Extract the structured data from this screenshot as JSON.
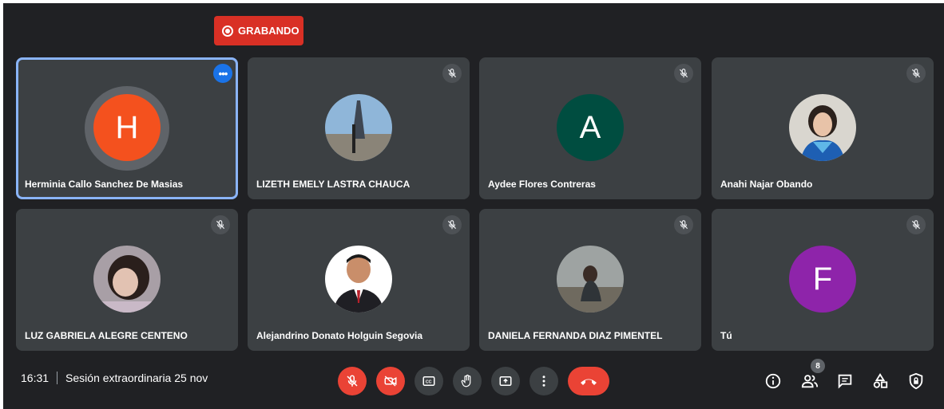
{
  "recording": {
    "label": "GRABANDO",
    "color": "#d93025"
  },
  "participants": [
    {
      "name": "Herminia Callo Sanchez De Masias",
      "initial": "H",
      "avatar_color": "#f4511e",
      "muted": false,
      "active": true,
      "options": true
    },
    {
      "name": "LIZETH EMELY LASTRA CHAUCA",
      "initial": "",
      "avatar": "photo-eiffel-tower",
      "muted": true
    },
    {
      "name": "Aydee Flores Contreras",
      "initial": "A",
      "avatar_color": "#004d40",
      "muted": true
    },
    {
      "name": "Anahi Najar Obando",
      "initial": "",
      "avatar": "photo-woman-blue-scarf",
      "muted": true
    },
    {
      "name": "LUZ GABRIELA ALEGRE CENTENO",
      "initial": "",
      "avatar": "photo-girl-selfie",
      "muted": true
    },
    {
      "name": "Alejandrino Donato Holguin Segovia",
      "initial": "",
      "avatar": "photo-man-suit",
      "muted": true
    },
    {
      "name": "DANIELA FERNANDA DIAZ PIMENTEL",
      "initial": "",
      "avatar": "photo-woman-landscape",
      "muted": true
    },
    {
      "name": "Tú",
      "initial": "F",
      "avatar_color": "#8e24aa",
      "muted": true
    }
  ],
  "meeting": {
    "time": "16:31",
    "title": "Sesión extraordinaria 25 nov"
  },
  "controls": [
    "mic-off-icon",
    "camera-off-icon",
    "captions-icon",
    "raise-hand-icon",
    "present-screen-icon",
    "more-options-icon",
    "hang-up-icon"
  ],
  "right_panel": {
    "participants_count": "8",
    "icons": [
      "info-icon",
      "people-icon",
      "chat-icon",
      "activities-icon",
      "host-controls-icon"
    ]
  },
  "colors": {
    "background": "#202124",
    "tile": "#3c4043",
    "accent": "#8ab4f8",
    "danger": "#ea4335"
  }
}
